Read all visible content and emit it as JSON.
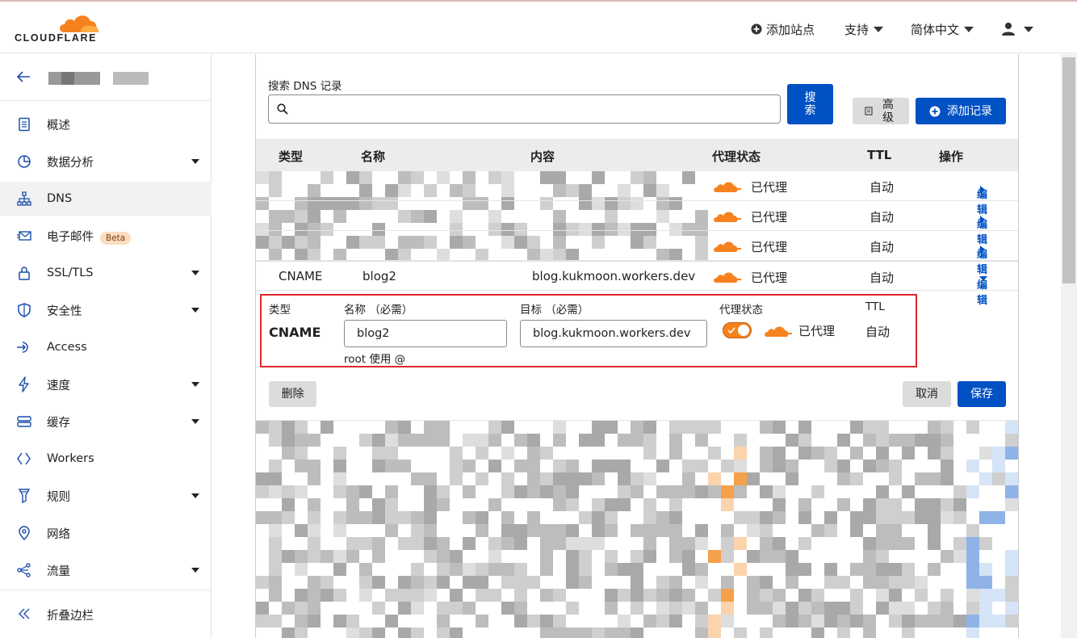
{
  "brand": {
    "wordmark": "CLOUDFLARE",
    "accent": "#f6821f",
    "primary": "#0051c3"
  },
  "topbar": {
    "add_site": "添加站点",
    "support": "支持",
    "language": "简体中文"
  },
  "sidebar": {
    "items": [
      {
        "label": "概述",
        "icon": "document-icon",
        "caret": false
      },
      {
        "label": "数据分析",
        "icon": "pie-chart-icon",
        "caret": true
      },
      {
        "label": "DNS",
        "icon": "network-tree-icon",
        "caret": false,
        "active": true
      },
      {
        "label": "电子邮件",
        "icon": "mail-icon",
        "caret": false,
        "badge": "Beta"
      },
      {
        "label": "SSL/TLS",
        "icon": "lock-icon",
        "caret": true
      },
      {
        "label": "安全性",
        "icon": "shield-icon",
        "caret": true
      },
      {
        "label": "Access",
        "icon": "sign-in-icon",
        "caret": false
      },
      {
        "label": "速度",
        "icon": "lightning-icon",
        "caret": true
      },
      {
        "label": "缓存",
        "icon": "server-stack-icon",
        "caret": true
      },
      {
        "label": "Workers",
        "icon": "code-brackets-icon",
        "caret": false
      },
      {
        "label": "规则",
        "icon": "filter-icon",
        "caret": true
      },
      {
        "label": "网络",
        "icon": "location-pin-icon",
        "caret": false
      },
      {
        "label": "流量",
        "icon": "share-nodes-icon",
        "caret": true
      }
    ],
    "collapse": "折叠边栏"
  },
  "search": {
    "label": "搜索 DNS 记录",
    "button": "搜索",
    "advanced": "高级",
    "add_record": "添加记录"
  },
  "table": {
    "headers": {
      "type": "类型",
      "name": "名称",
      "content": "内容",
      "proxy": "代理状态",
      "ttl": "TTL",
      "actions": "操作"
    },
    "rows": [
      {
        "type": "",
        "name": "",
        "content": "",
        "proxy": "已代理",
        "ttl": "自动",
        "action": "编辑"
      },
      {
        "type": "",
        "name": "",
        "content": "",
        "proxy": "已代理",
        "ttl": "自动",
        "action": "编辑"
      },
      {
        "type": "",
        "name": "",
        "content": "",
        "proxy": "已代理",
        "ttl": "自动",
        "action": "编辑"
      },
      {
        "type": "CNAME",
        "name": "blog2",
        "content": "blog.kukmoon.workers.dev",
        "proxy": "已代理",
        "ttl": "自动",
        "action": "编辑"
      }
    ]
  },
  "edit_form": {
    "type_label": "类型",
    "type_value": "CNAME",
    "name_label": "名称 （必需）",
    "name_value": "blog2",
    "name_hint": "root 使用 @",
    "target_label": "目标 （必需）",
    "target_value": "blog.kukmoon.workers.dev",
    "proxy_label": "代理状态",
    "proxy_value": "已代理",
    "proxy_on": true,
    "ttl_label": "TTL",
    "ttl_value": "自动",
    "delete": "删除",
    "cancel": "取消",
    "save": "保存"
  }
}
